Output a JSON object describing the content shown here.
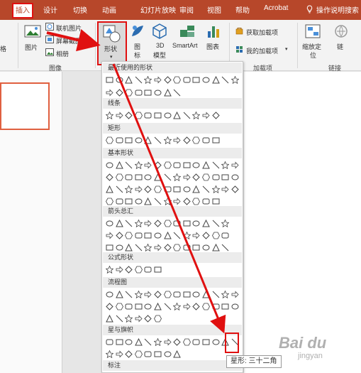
{
  "tabs": {
    "insert": "插入",
    "design": "设计",
    "transitions": "切换",
    "animations": "动画",
    "slideshow": "幻灯片放映",
    "review": "审阅",
    "view": "视图",
    "help": "帮助",
    "acrobat": "Acrobat",
    "tell_me": "操作说明搜索"
  },
  "ribbon": {
    "table_partial": "格",
    "picture": "图片",
    "online_picture": "联机图片",
    "screenshot": "屏幕截图",
    "album": "相册",
    "shapes": "形状",
    "icons_line1": "图",
    "icons_line2": "标",
    "models_line1": "3D",
    "models_line2": "模型",
    "smartart": "SmartArt",
    "chart": "图表",
    "get_addins": "获取加载项",
    "my_addins": "我的加载项",
    "zoom_line1": "缩放定",
    "zoom_line2": "位",
    "link_partial": "链",
    "groups": {
      "table_partial": "格",
      "images": "图像",
      "addins": "加载项",
      "links": "链接"
    }
  },
  "gallery": {
    "sections": [
      {
        "title": "最近使用的形状"
      },
      {
        "title": "线条"
      },
      {
        "title": "矩形"
      },
      {
        "title": "基本形状"
      },
      {
        "title": "箭头总汇"
      },
      {
        "title": "公式形状"
      },
      {
        "title": "流程图"
      },
      {
        "title": "星与旗帜"
      },
      {
        "title": "标注"
      }
    ]
  },
  "tooltip": "星形: 三十二角",
  "watermark": {
    "line1": "Bai du",
    "line2": "jingyan"
  },
  "colors": {
    "accent": "#b7472a",
    "annotation": "#e01010"
  }
}
